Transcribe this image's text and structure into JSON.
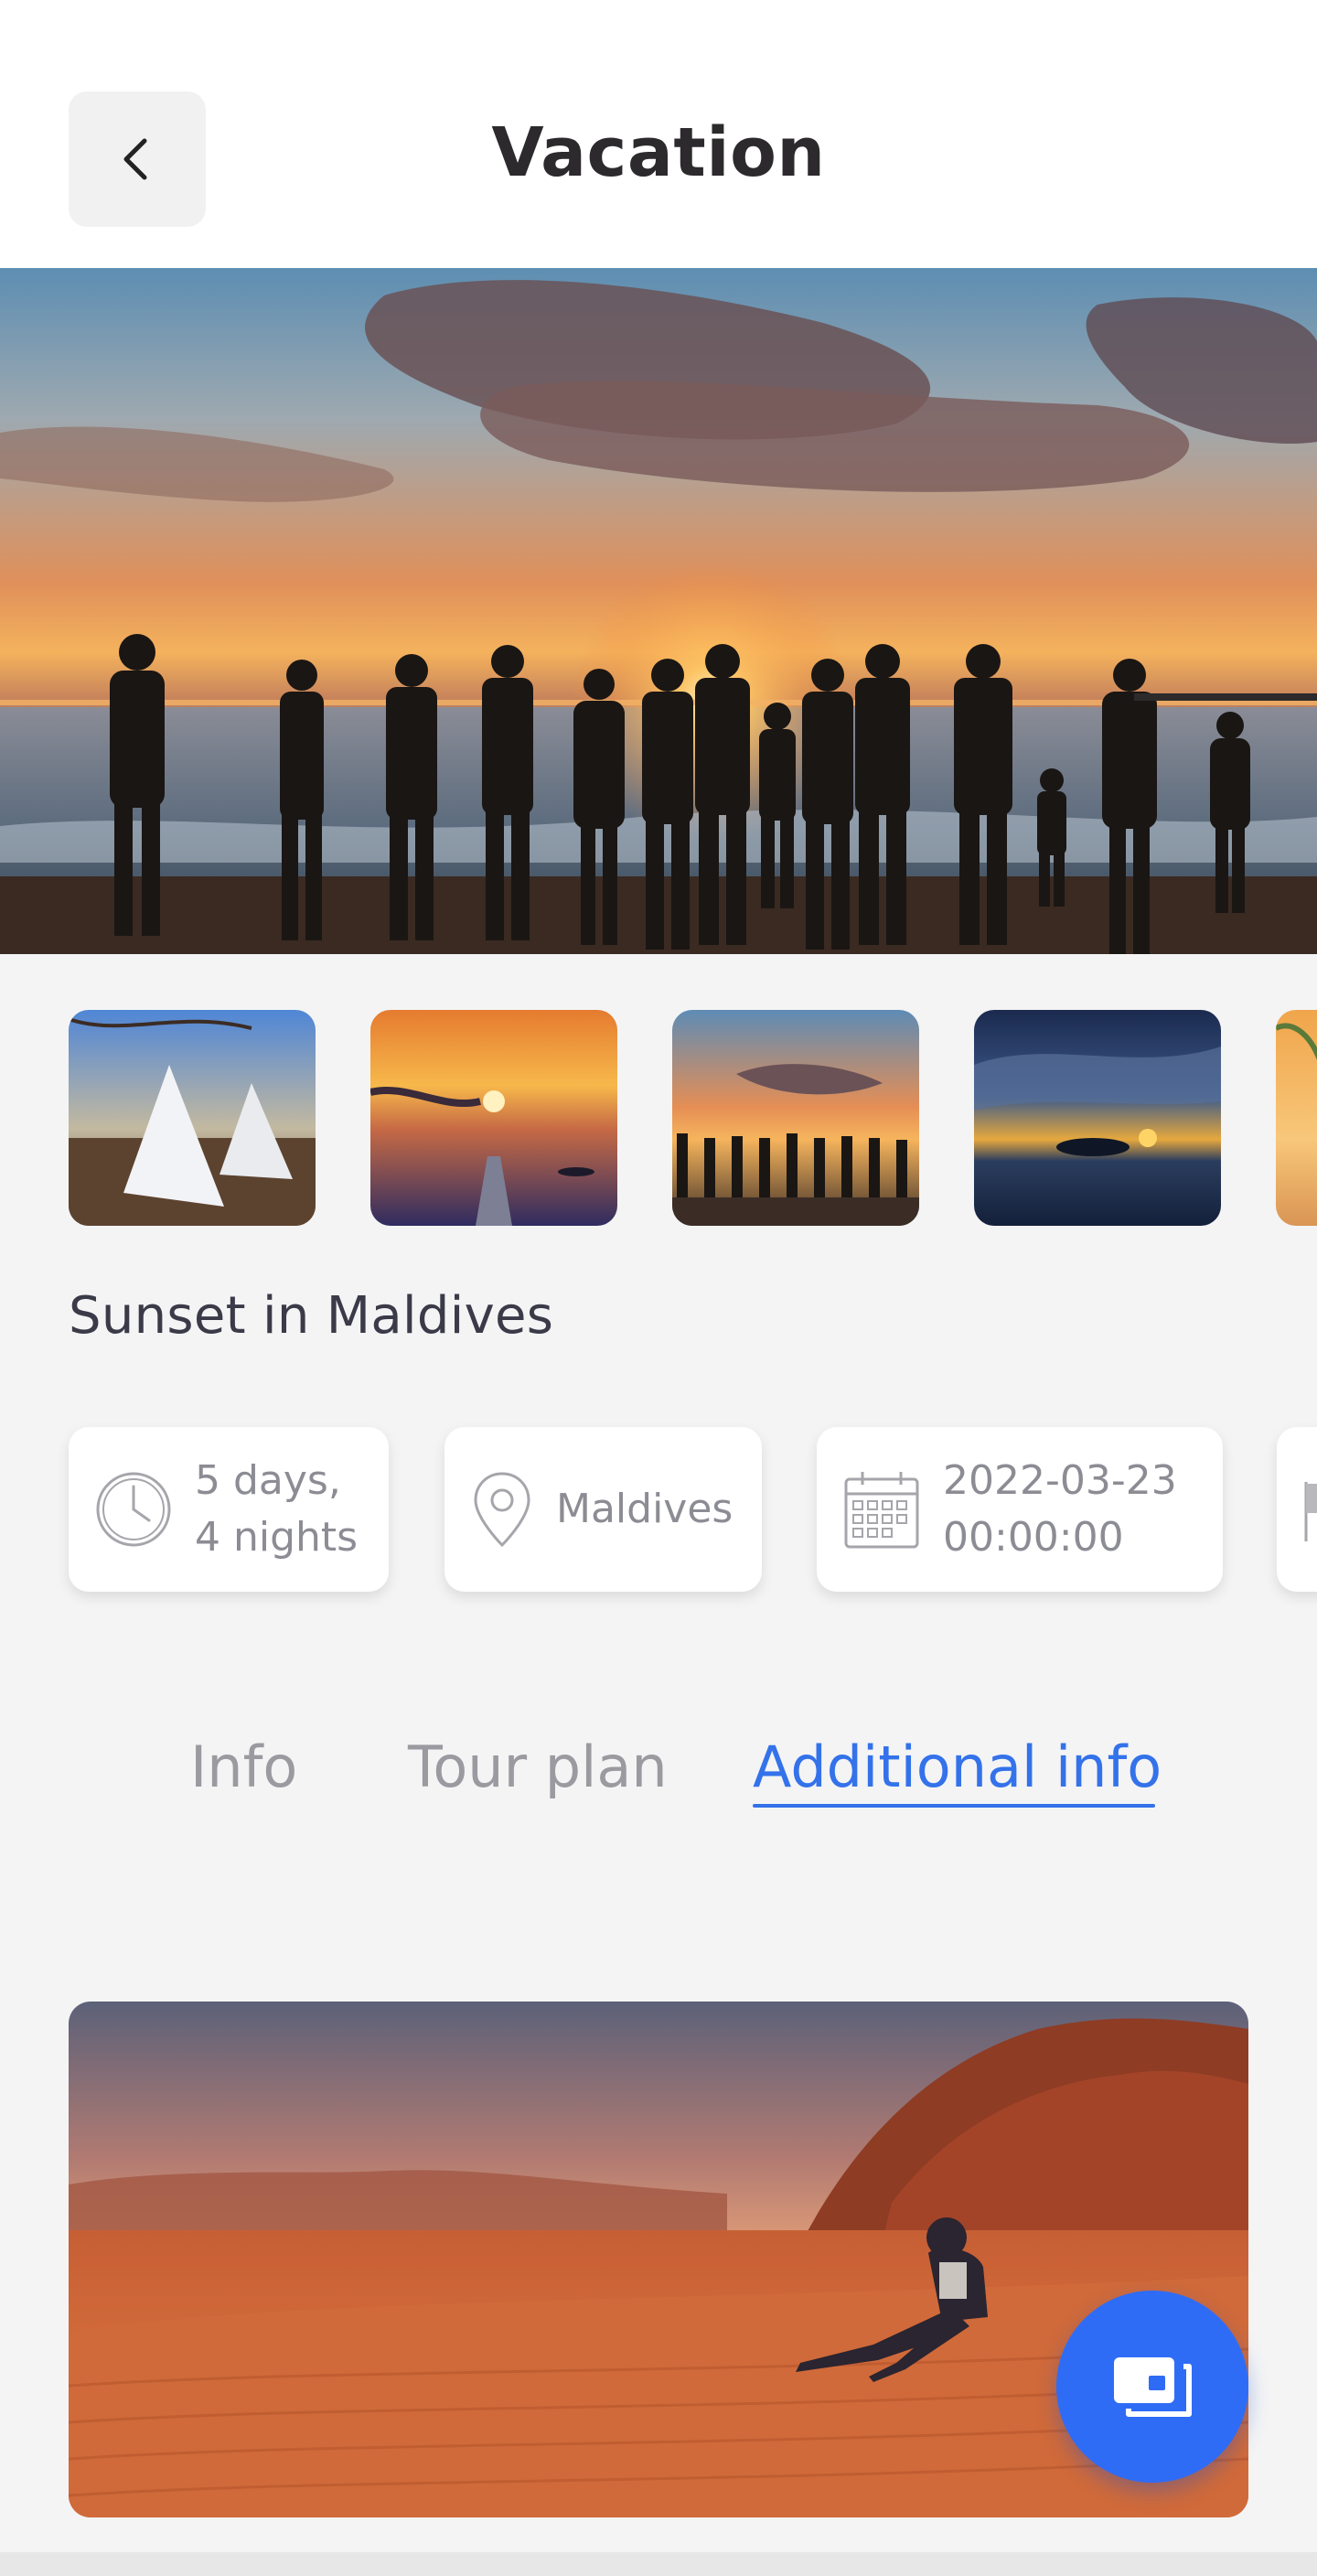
{
  "header": {
    "title": "Vacation",
    "back_icon": "chevron-left-icon"
  },
  "gallery": {
    "thumbnails": [
      {
        "subject": "beach canopy beds"
      },
      {
        "subject": "lake pier at sunset"
      },
      {
        "subject": "family on beach at sunset"
      },
      {
        "subject": "dramatic sky over sea"
      },
      {
        "subject": "palm beach"
      }
    ]
  },
  "trip": {
    "name": "Sunset in Maldives",
    "chips": [
      {
        "icon": "clock-icon",
        "line1": "5 days,",
        "line2": "4 nights"
      },
      {
        "icon": "location-pin-icon",
        "line1": "Maldives"
      },
      {
        "icon": "calendar-icon",
        "line1": "2022-03-23",
        "line2": "00:00:00"
      },
      {
        "icon": "flag-icon"
      }
    ]
  },
  "tabs": [
    {
      "label": "Info",
      "active": false
    },
    {
      "label": "Tour plan",
      "active": false
    },
    {
      "label": "Additional info",
      "active": true
    }
  ],
  "colors": {
    "accent": "#3472ea",
    "fab": "#2f6cf6",
    "background": "#f4f4f5",
    "card": "#ffffff"
  },
  "fab": {
    "icon": "photo-gallery-icon"
  }
}
